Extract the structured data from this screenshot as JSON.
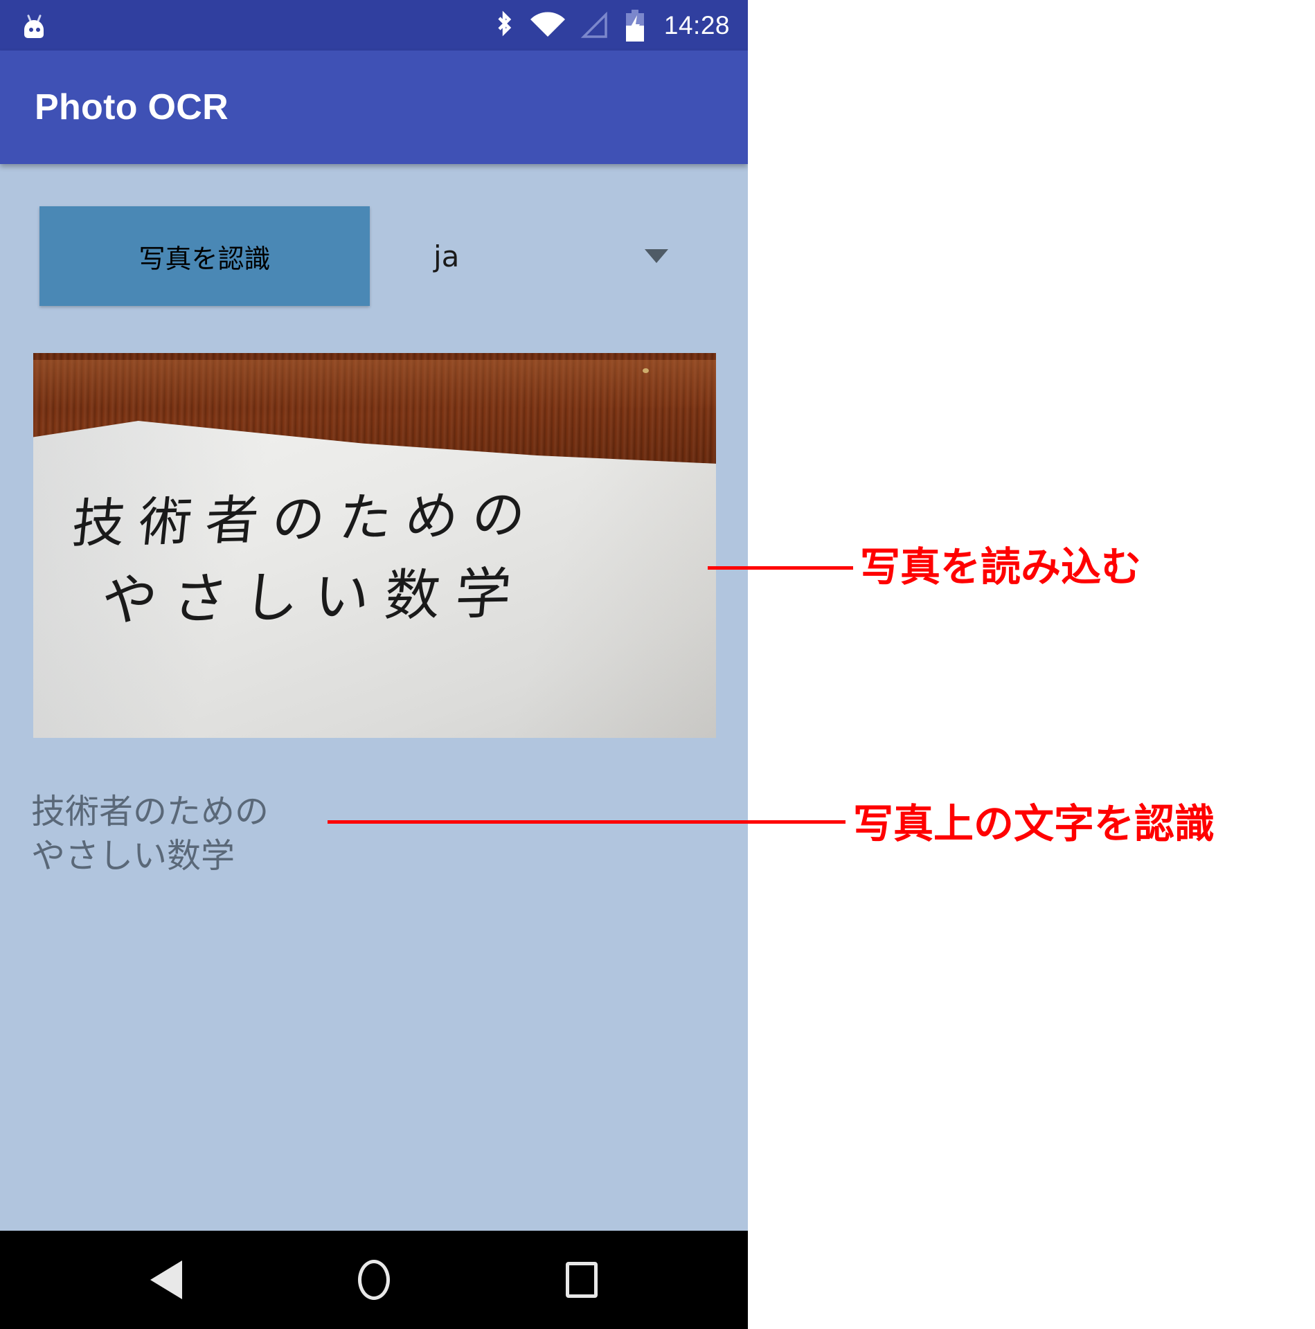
{
  "device": {
    "status_bar": {
      "android_logo_icon": "android-logo-icon",
      "icons": [
        "bluetooth-icon",
        "wifi-icon",
        "cellular-signal-icon",
        "battery-charging-icon"
      ],
      "time": "14:28"
    },
    "app_bar": {
      "title": "Photo OCR"
    },
    "nav_bar": {
      "back_icon": "back-triangle-icon",
      "home_icon": "home-circle-icon",
      "recents_icon": "recents-square-icon"
    }
  },
  "screen": {
    "recognize_button_label": "写真を認識",
    "language_spinner": {
      "value": "ja",
      "caret_icon": "chevron-down-icon"
    },
    "photo_preview": {
      "handwriting_line1": "技術者のための",
      "handwriting_line2": "やさしい数学"
    },
    "ocr_result_text": "技術者のための\nやさしい数学"
  },
  "annotations": [
    {
      "label": "写真を読み込む"
    },
    {
      "label": "写真上の文字を認識"
    }
  ],
  "colors": {
    "status_bar": "#303f9f",
    "app_bar": "#3f51b5",
    "screen_background": "#b1c5de",
    "button": "#4a88b5",
    "ocr_text": "#5a6878",
    "annotation": "#ff0000",
    "nav_bar": "#000000"
  }
}
